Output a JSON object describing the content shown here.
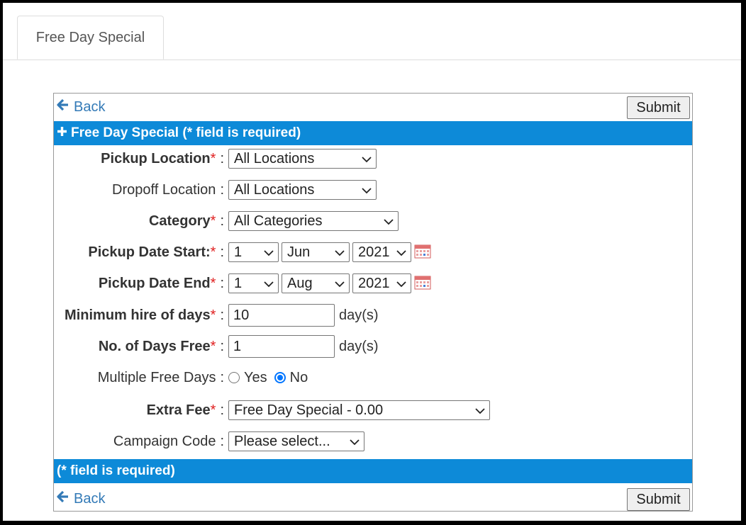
{
  "tab": {
    "label": "Free Day Special"
  },
  "nav": {
    "back_label": "Back",
    "submit_label": "Submit"
  },
  "header_bar": {
    "title": "Free Day Special (* field is required)"
  },
  "footer_bar": {
    "text": "(* field is required)"
  },
  "form": {
    "required_mark": "*",
    "colon": ":",
    "pickup_location": {
      "label": "Pickup Location",
      "value": "All Locations"
    },
    "dropoff_location": {
      "label": "Dropoff Location",
      "value": "All Locations"
    },
    "category": {
      "label": "Category",
      "value": "All Categories"
    },
    "pickup_date_start": {
      "label": "Pickup Date Start:",
      "day": "1",
      "month": "Jun",
      "year": "2021"
    },
    "pickup_date_end": {
      "label": "Pickup Date End",
      "day": "1",
      "month": "Aug",
      "year": "2021"
    },
    "min_hire_days": {
      "label": "Minimum hire of days",
      "value": "10",
      "unit": "day(s)"
    },
    "days_free": {
      "label": "No. of Days Free",
      "value": "1",
      "unit": "day(s)"
    },
    "multiple_free_days": {
      "label": "Multiple Free Days",
      "yes_label": "Yes",
      "no_label": "No",
      "selected": "No"
    },
    "extra_fee": {
      "label": "Extra Fee",
      "value": "Free Day Special - 0.00"
    },
    "campaign_code": {
      "label": "Campaign Code",
      "value": "Please select..."
    }
  },
  "colors": {
    "accent_bar": "#0d8ad8",
    "link": "#337ab7",
    "required": "#e02020"
  },
  "icons": {
    "back": "arrow-left-icon",
    "plus": "plus-icon",
    "calendar": "calendar-icon",
    "dropdown": "chevron-down-icon"
  }
}
